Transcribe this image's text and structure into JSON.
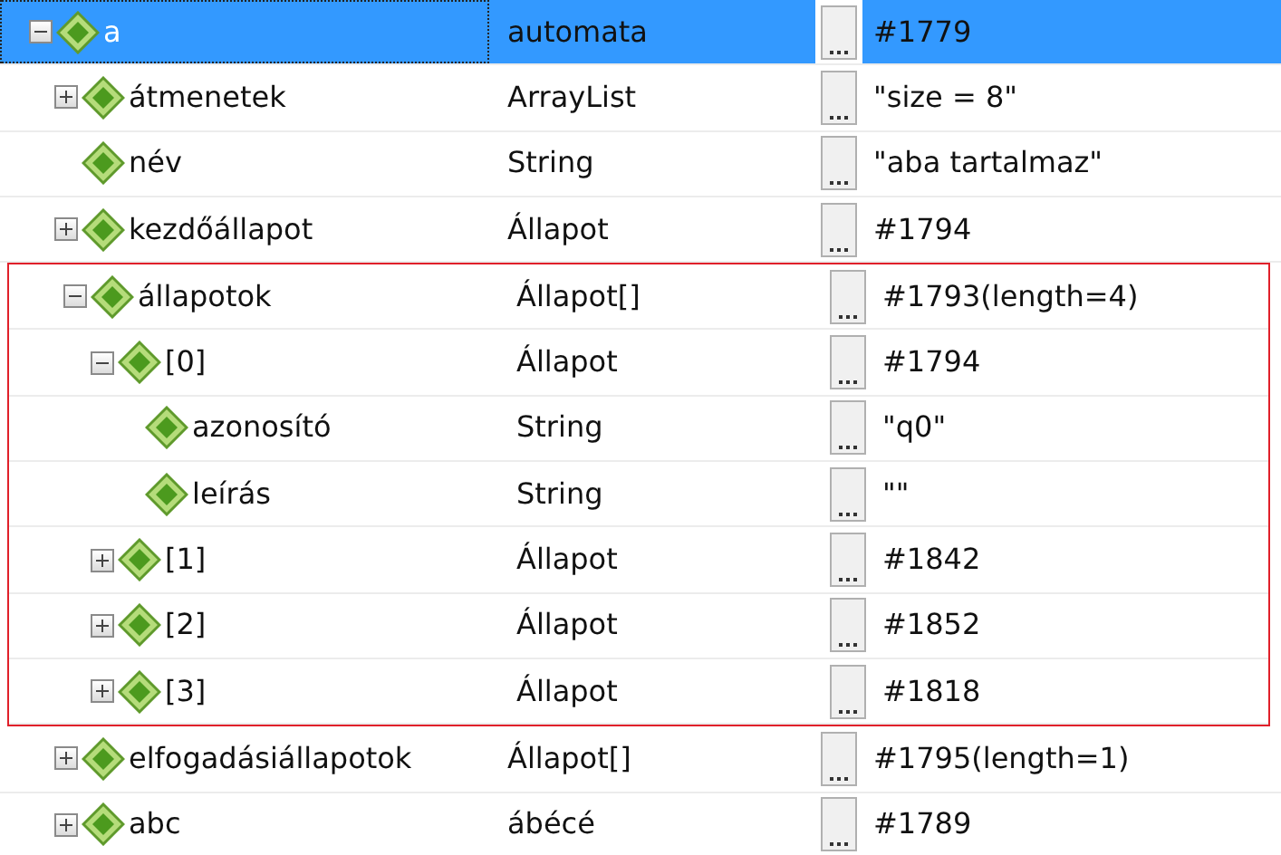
{
  "root": {
    "name": "a",
    "type": "automata",
    "value": "#1779",
    "expanded": true,
    "selected": true,
    "children": [
      {
        "name": "átmenetek",
        "type": "ArrayList",
        "value": "\"size = 8\"",
        "expanded": false,
        "selected": false,
        "highlighted": false
      },
      {
        "name": "név",
        "type": "String",
        "value": "\"aba tartalmaz\"",
        "selected": false,
        "highlighted": false
      },
      {
        "name": "kezdőállapot",
        "type": "Állapot",
        "value": "#1794",
        "expanded": false,
        "selected": false,
        "highlighted": false
      },
      {
        "name": "állapotok",
        "type": "Állapot[]",
        "value": "#1793(length=4)",
        "expanded": true,
        "selected": false,
        "highlighted": true,
        "children": [
          {
            "name": "[0]",
            "type": "Állapot",
            "value": "#1794",
            "expanded": true,
            "selected": false,
            "children": [
              {
                "name": "azonosító",
                "type": "String",
                "value": "\"q0\"",
                "selected": false
              },
              {
                "name": "leírás",
                "type": "String",
                "value": "\"\"",
                "selected": false
              }
            ]
          },
          {
            "name": "[1]",
            "type": "Állapot",
            "value": "#1842",
            "expanded": false,
            "selected": false
          },
          {
            "name": "[2]",
            "type": "Állapot",
            "value": "#1852",
            "expanded": false,
            "selected": false
          },
          {
            "name": "[3]",
            "type": "Állapot",
            "value": "#1818",
            "expanded": false,
            "selected": false
          }
        ]
      },
      {
        "name": "elfogadásiállapotok",
        "type": "Állapot[]",
        "value": "#1795(length=1)",
        "expanded": false,
        "selected": false,
        "highlighted": false
      },
      {
        "name": "abc",
        "type": "ábécé",
        "value": "#1789",
        "expanded": false,
        "selected": false,
        "highlighted": false
      }
    ]
  }
}
